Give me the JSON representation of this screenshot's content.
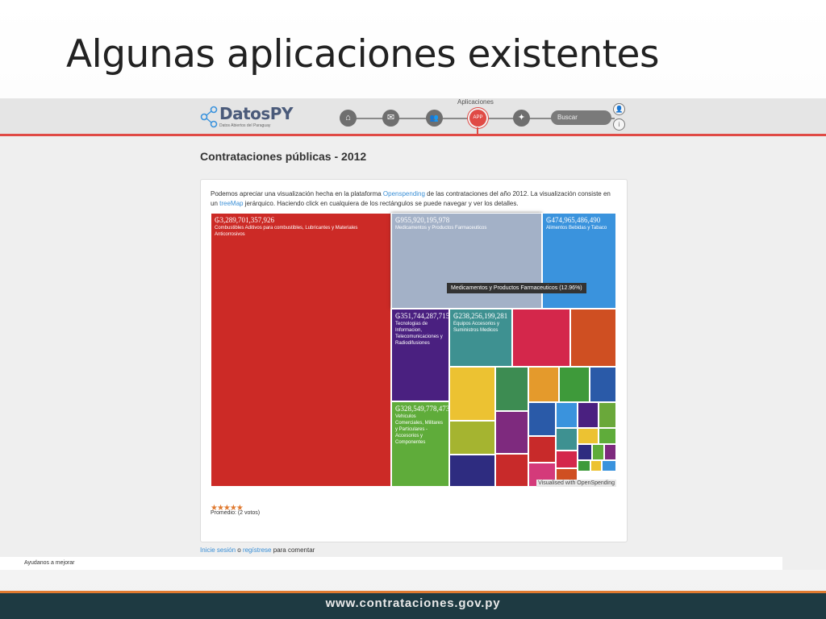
{
  "slide": {
    "title": "Algunas aplicaciones existentes"
  },
  "header": {
    "logo_text": "DatosPY",
    "logo_sub": "Datos Abiertos del Paraguay",
    "active_nav_label": "Aplicaciones",
    "nav_items": [
      {
        "icon": "home-icon",
        "glyph": "⌂"
      },
      {
        "icon": "inbox-icon",
        "glyph": "✉"
      },
      {
        "icon": "people-icon",
        "glyph": "👥"
      },
      {
        "icon": "apps-icon",
        "glyph": "APP"
      },
      {
        "icon": "rocket-icon",
        "glyph": "✦"
      }
    ],
    "search_placeholder": "Buscar",
    "user_icons": [
      "👤",
      "i"
    ]
  },
  "page": {
    "heading": "Contrataciones públicas - 2012",
    "desc_1": "Podemos apreciar una visualización hecha en la plataforma ",
    "desc_link_1": "Openspending",
    "desc_2": " de las contrataciones del año 2012. La visualización consiste en un ",
    "desc_link_2": "treeMap",
    "desc_3": " jerárquico. Haciendo click en cualquiera de los rectángulos se puede navegar y ver los detalles."
  },
  "treemap": {
    "tiles": [
      {
        "value": "₲3,289,701,357,926",
        "label": "Combustibles Aditivos para combustibles, Lubricantes y Materiales Anticorrosivos",
        "color": "#cc2a26"
      },
      {
        "value": "₲955,920,195,978",
        "label": "Medicamentos y Productos Farmaceuticos",
        "color": "#a3b1c7"
      },
      {
        "value": "₲474,965,486,490",
        "label": "Alimentos Bebidas y Tabaco",
        "color": "#3a93dd"
      },
      {
        "value": "₲351,744,287,715",
        "label": "Tecnologias de Informacion, Telecomunicaciones y Radiodifusiones",
        "color": "#4a2080"
      },
      {
        "value": "₲238,256,199,281",
        "label": "Equipos Accesorios y Suministros Medicos",
        "color": "#3e9191"
      },
      {
        "value": "₲328,549,778,473",
        "label": "Vehiculos Comerciales, Militares y Particulares - Accesorios y Componentes",
        "color": "#5fac3a"
      }
    ],
    "tooltip": "Medicamentos y Productos Farmaceuticos (12.96%)",
    "credit": "Visualised with OpenSpending"
  },
  "rating": {
    "stars": "★★★★★",
    "average": "Promedio: (2 votos)"
  },
  "comments": {
    "login_link": "Inicie sesión",
    "or": " o ",
    "register_link": "regístrese",
    "rest": " para comentar"
  },
  "help": {
    "text": "Ayudanos a mejorar"
  },
  "footer": {
    "url": "www.contrataciones.gov.py"
  }
}
